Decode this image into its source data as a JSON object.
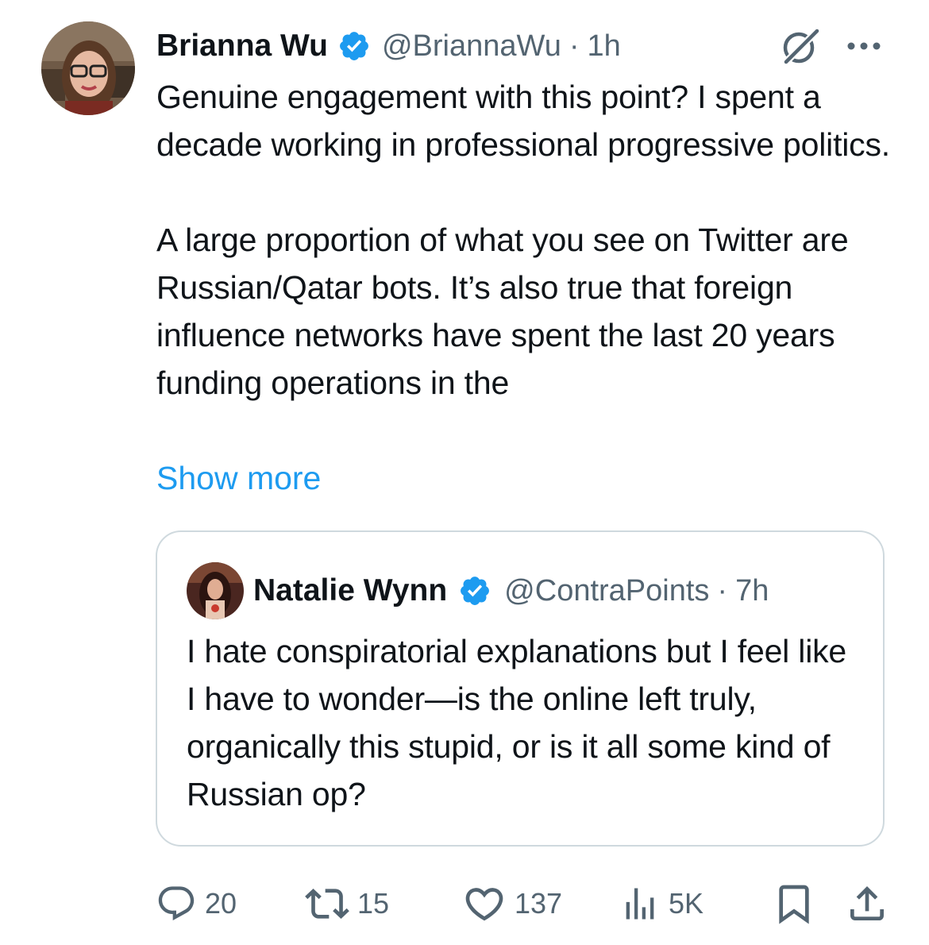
{
  "tweet": {
    "author_name": "Brianna Wu",
    "author_handle": "@BriannaWu",
    "separator": "·",
    "time": "1h",
    "paragraph1": "Genuine engagement with this point? I spent a decade working in professional progressive politics.",
    "paragraph2": "A large proportion of what you see on Twitter are Russian/Qatar bots. It’s also true that foreign influence networks have spent the last 20 years funding operations in the",
    "show_more": "Show more"
  },
  "quoted_tweet": {
    "author_name": "Natalie Wynn",
    "author_handle": "@ContraPoints",
    "separator": "·",
    "time": "7h",
    "text": "I hate conspiratorial explanations but I feel like I have to wonder—is the online left truly, organically this stupid, or is it all some kind of Russian op?"
  },
  "stats": {
    "replies": "20",
    "reposts": "15",
    "likes": "137",
    "views": "5K"
  },
  "icons": {
    "reply": "reply-icon",
    "repost": "repost-icon",
    "like": "heart-icon",
    "views": "views-icon",
    "bookmark": "bookmark-icon",
    "share": "share-icon",
    "grok": "grok-icon",
    "more": "more-icon",
    "verified": "verified-badge-icon"
  },
  "colors": {
    "text": "#0f1419",
    "secondary": "#536471",
    "link": "#1d9bf0",
    "verified": "#1d9bf0",
    "border": "#cfd9de"
  }
}
